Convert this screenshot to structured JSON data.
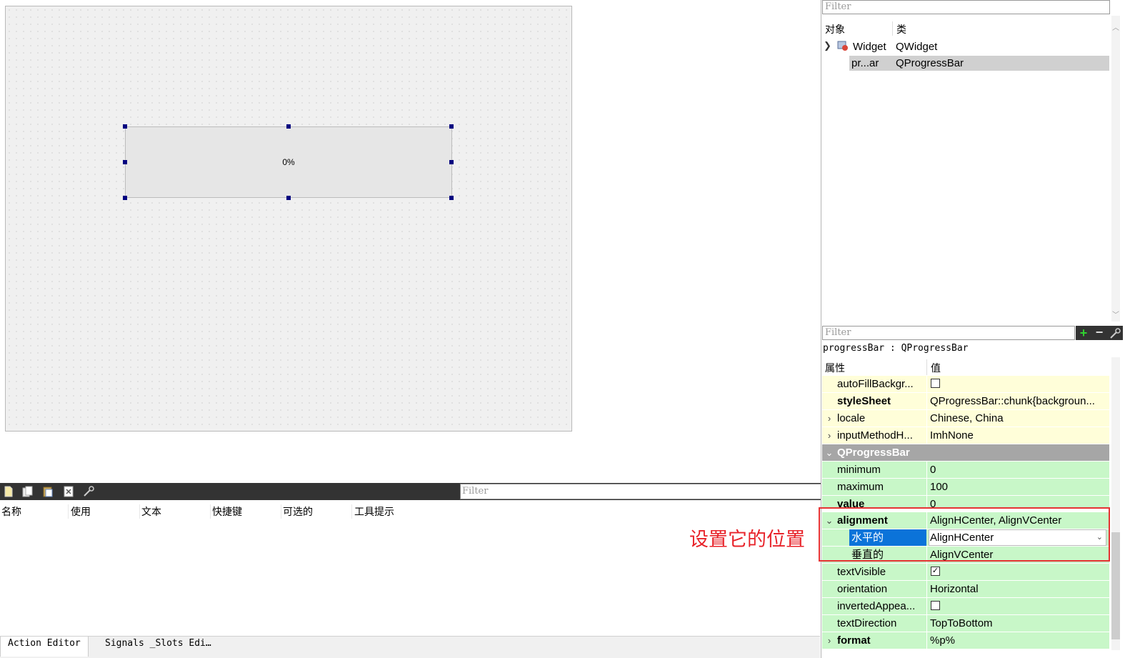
{
  "action_editor": {
    "filter_placeholder": "Filter",
    "columns": [
      "名称",
      "使用",
      "文本",
      "快捷键",
      "可选的",
      "工具提示"
    ],
    "tabs": [
      "Action Editor",
      "Signals _Slots Edi…"
    ]
  },
  "canvas": {
    "progress_text": "0%"
  },
  "object_inspector": {
    "filter_placeholder": "Filter",
    "col_object": "对象",
    "col_class": "类",
    "rows": [
      {
        "name": "Widget",
        "class": "QWidget"
      },
      {
        "name": "pr...ar",
        "class": "QProgressBar"
      }
    ]
  },
  "property_editor": {
    "filter_placeholder": "Filter",
    "object_label": "progressBar : QProgressBar",
    "col_property": "属性",
    "col_value": "值",
    "props": {
      "autoFill": "autoFillBackgr...",
      "styleSheet_name": "styleSheet",
      "styleSheet_value": "QProgressBar::chunk{backgroun...",
      "locale_name": "locale",
      "locale_value": "Chinese, China",
      "inputMethod_name": "inputMethodH...",
      "inputMethod_value": "ImhNone",
      "group": "QProgressBar",
      "minimum_name": "minimum",
      "minimum_value": "0",
      "maximum_name": "maximum",
      "maximum_value": "100",
      "value_name": "value",
      "value_value": "0",
      "alignment_name": "alignment",
      "alignment_value": "AlignHCenter, AlignVCenter",
      "horizontal_name": "水平的",
      "horizontal_value": "AlignHCenter",
      "vertical_name": "垂直的",
      "vertical_value": "AlignVCenter",
      "textVisible_name": "textVisible",
      "orientation_name": "orientation",
      "orientation_value": "Horizontal",
      "inverted_name": "invertedAppea...",
      "textDirection_name": "textDirection",
      "textDirection_value": "TopToBottom",
      "format_name": "format",
      "format_value": "%p%"
    },
    "autoFill_checked": false,
    "textVisible_checked": true,
    "inverted_checked": false
  },
  "annotation": "设置它的位置",
  "colors": {
    "annotation_red": "#e8232a",
    "selection_blue": "#0b73d9",
    "property_green": "#c8f7c8",
    "property_yellow": "#fffed9"
  }
}
